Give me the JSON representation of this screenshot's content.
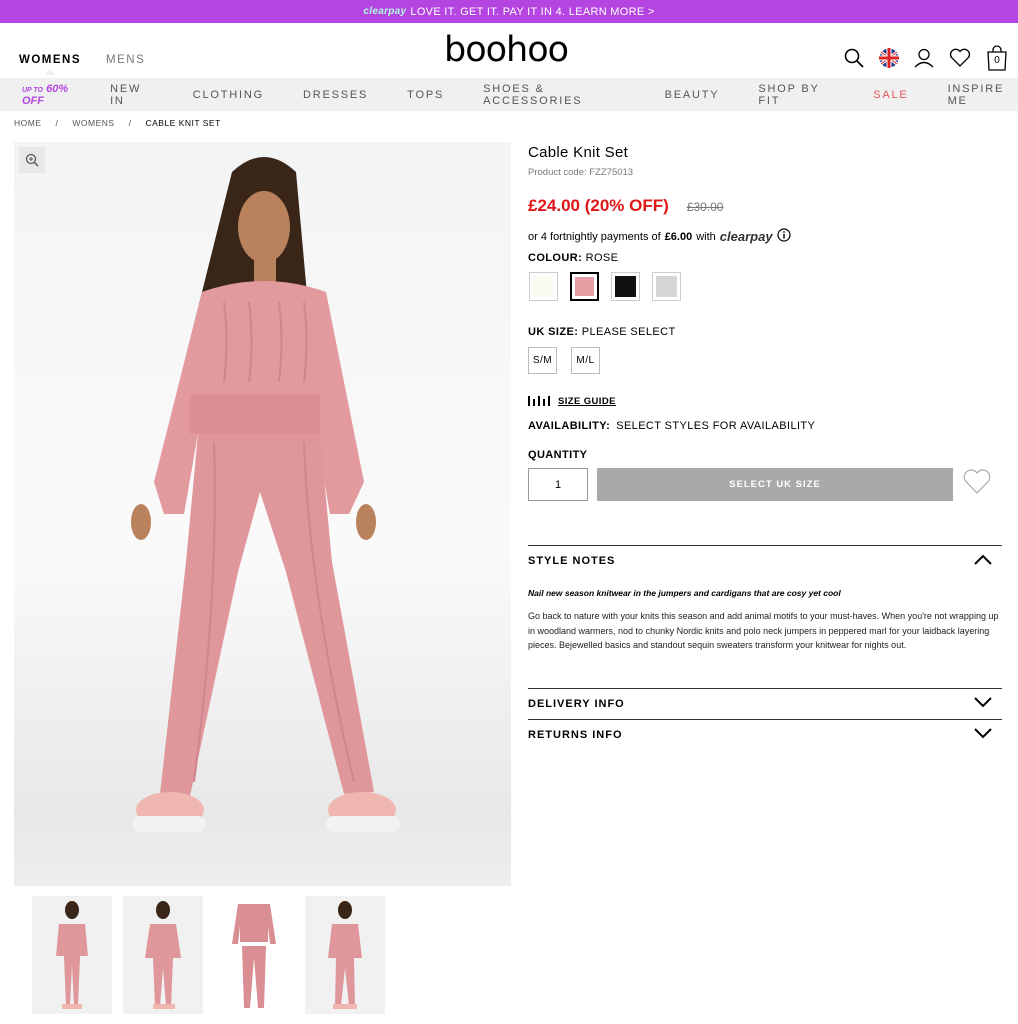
{
  "promo": {
    "brand": "clearpay",
    "text": "LOVE IT. GET IT. PAY IT IN 4. LEARN MORE >"
  },
  "header": {
    "womens": "WOMENS",
    "mens": "MENS",
    "logo": "boohoo",
    "bag_count": "0"
  },
  "nav": {
    "deal_prefix": "UP TO",
    "deal": "60% OFF",
    "items": [
      "NEW IN",
      "CLOTHING",
      "DRESSES",
      "TOPS",
      "SHOES & ACCESSORIES",
      "BEAUTY",
      "SHOP BY FIT",
      "SALE",
      "INSPIRE ME"
    ]
  },
  "breadcrumb": [
    "HOME",
    "/",
    "WOMENS",
    "/",
    "CABLE KNIT SET"
  ],
  "product": {
    "title": "Cable Knit Set",
    "code": "Product code: FZZ75013",
    "price": "£24.00 (20% OFF)",
    "was": "£30.00",
    "pay_prefix": "or 4 fortnightly payments of",
    "pay_amount": "£6.00",
    "pay_with": "with",
    "pay_brand": "clearpay",
    "colour_label": "COLOUR:",
    "colour_value": "ROSE",
    "swatches": [
      "#fbfaf3",
      "#e69ea4",
      "#111111",
      "#d6d6d6"
    ],
    "size_label": "UK SIZE:",
    "size_value": "PLEASE SELECT",
    "sizes": [
      "S/M",
      "M/L"
    ],
    "size_guide": "SIZE GUIDE",
    "avail_label": "AVAILABILITY:",
    "avail_value": "SELECT STYLES FOR AVAILABILITY",
    "qty_label": "QUANTITY",
    "qty_value": "1",
    "add_label": "SELECT UK SIZE"
  },
  "style_notes": {
    "title": "STYLE NOTES",
    "intro": "Nail new season knitwear in the jumpers and cardigans that are cosy yet cool",
    "body": "Go back to nature with your knits this season and add animal motifs to your must-haves. When you're not wrapping up in woodland warmers, nod to chunky Nordic knits and polo neck jumpers in peppered marl for your laidback layering pieces. Bejewelled basics and standout sequin sweaters transform your knitwear for nights out."
  },
  "delivery": {
    "title": "DELIVERY INFO"
  },
  "returns": {
    "title": "RETURNS INFO"
  },
  "colors": {
    "promo": "#b545e0",
    "sale": "#e01717",
    "pink": "#e39a9f"
  }
}
